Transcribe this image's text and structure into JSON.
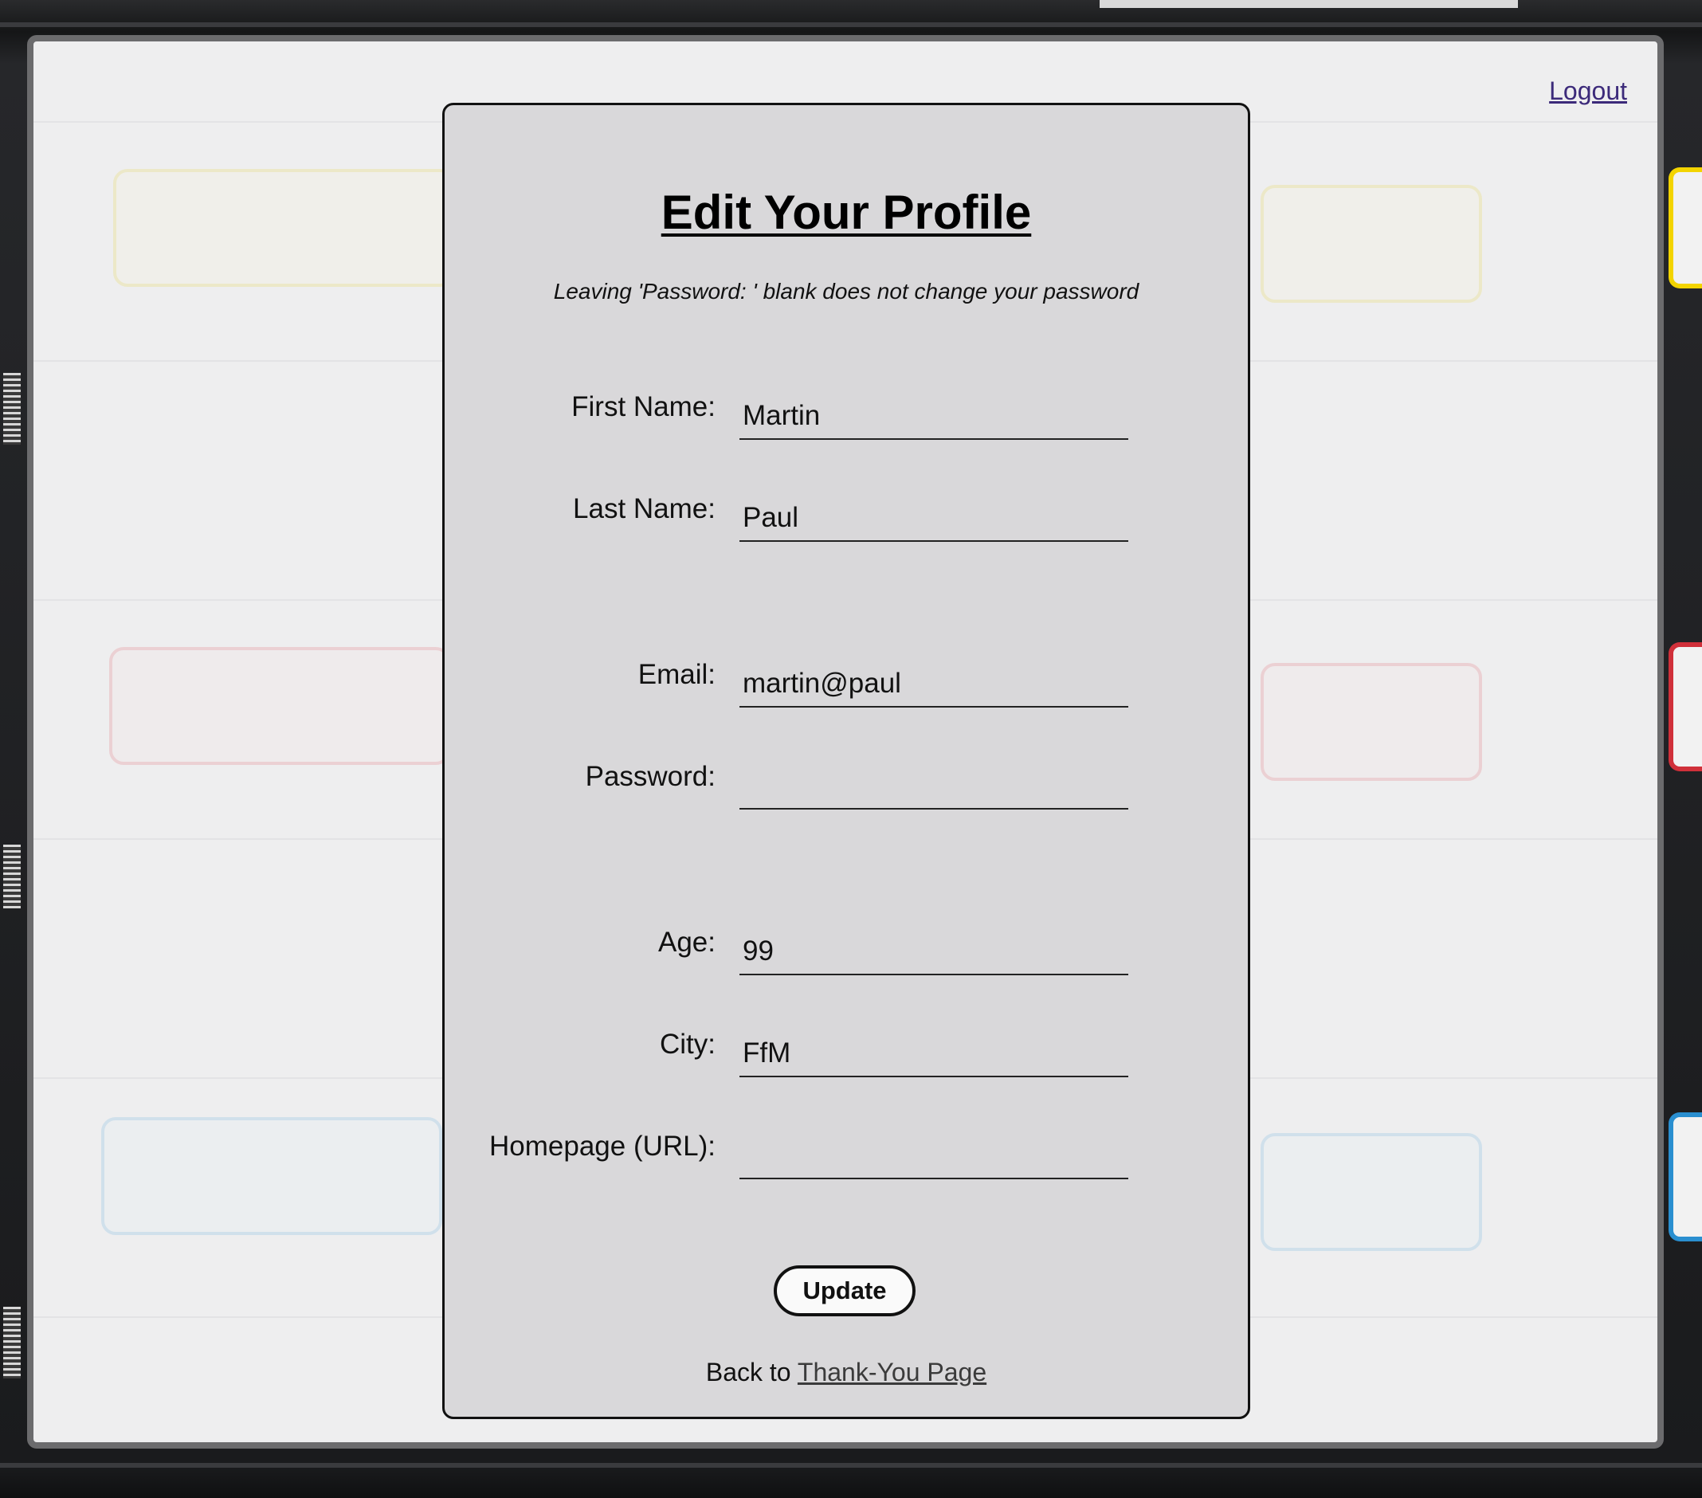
{
  "header": {
    "logout_label": "Logout"
  },
  "form": {
    "title": "Edit Your Profile",
    "note": "Leaving 'Password: ' blank does not change your password",
    "fields": [
      {
        "label": "First Name:",
        "value": "Martin"
      },
      {
        "label": "Last Name:",
        "value": "Paul"
      },
      {
        "label": "Email:",
        "value": "martin@paul"
      },
      {
        "label": "Password:",
        "value": ""
      },
      {
        "label": "Age:",
        "value": "99"
      },
      {
        "label": "City:",
        "value": "FfM"
      },
      {
        "label": "Homepage (URL):",
        "value": ""
      }
    ],
    "submit_label": "Update",
    "back_prefix": "Back to",
    "back_link_label": "Thank-You Page"
  },
  "colors": {
    "card_background": "#d9d8da",
    "panel_background": "#eeeeef",
    "link_visited": "#3c2a7a"
  }
}
